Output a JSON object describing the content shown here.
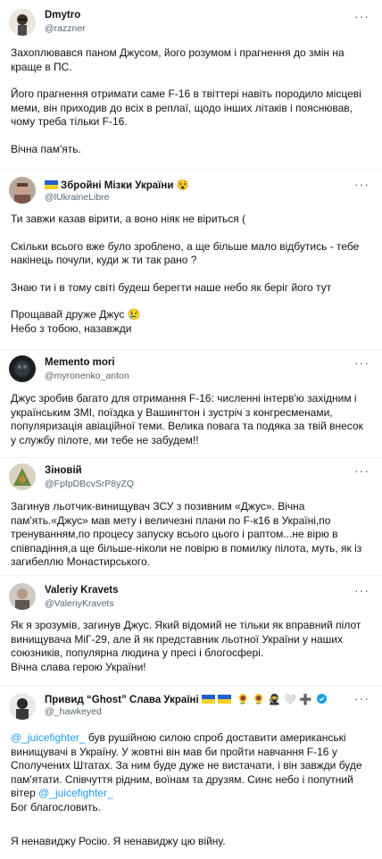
{
  "tweets": [
    {
      "name": "Dmytro",
      "handle": "@razzner",
      "more": "···",
      "lines": [
        "Захоплювався паном Джусом, його розумом і прагнення до змін на краще в ПС.",
        "",
        "Його прагнення отримати саме F-16 в твіттері навіть породило місцеві меми, він приходив до всіх в реплаї, щодо інших літаків і пояснював, чому треба тільки F-16.",
        "",
        "Вічна пам'ять."
      ]
    },
    {
      "name": "Збройні Мізки України",
      "name_emoji": "😵",
      "handle": "@lUkraineLibre",
      "more": "···",
      "lines": [
        "Ти завжи казав вірити, а воно ніяк не віриться (",
        "",
        "Скільки всього вже було зроблено, а ще більше мало відбутись - тебе накінець почули, куди ж ти так рано ?",
        "",
        "Знаю ти і в тому світі будеш берегти наше небо як беріг його тут",
        "",
        "Прощавай друже Джус 😢",
        "Небо з тобою, назавжди"
      ]
    },
    {
      "name": "Memento mori",
      "handle": "@myronenko_anton",
      "more": "···",
      "lines": [
        "Джус зробив багато для отримання F-16: численні інтерв'ю західним і українським ЗМІ, поїздка у Вашингтон і зустріч з конгресменами, популяризація авіаційної теми. Велика повага та подяка за твій внесок у службу пілоте, ми тебе не забудем!!"
      ]
    },
    {
      "name": "Зіновій",
      "handle": "@FpfpDBcvSrP8yZQ",
      "more": "···",
      "lines": [
        "Загинув льотчик-винищувач  ЗСУ з позивним «Джус». Вічна пам'ять.«Джус» мав мету і величезні плани по F-к16 в Україні,по тренуванням,по процесу запуску всього цього і раптом...не вірю в співпадіння,а ще більше-ніколи не повірю в помилку пілота, муть, як із загибеллю Монастирського."
      ]
    },
    {
      "name": "Valeriy Kravets",
      "handle": "@ValeriyKravets",
      "more": "···",
      "lines": [
        "Як я зрозумів, загинув Джус. Який відомий не тільки як вправний пілот винищувача МіГ-29, але й як представник льотної України у наших союзників, популярна людина у пресі і блогосфері.",
        "Вічна слава герою України!"
      ]
    },
    {
      "name": "Привид “Ghost” Слава Україні",
      "name_emoji": "🌻 🌻 🥷 🤍 ➕",
      "handle": "@_hawkeyed",
      "more": "···",
      "mention1": "@_juicefighter_",
      "text1": " був рушійною силою спроб доставити американські винищувачі в Україну. У жовтні він мав би пройти навчання F-16 у Сполучених Штатах. За ним буде дуже не вистачати, і він завжди буде пам'ятати. Співчуття рідним, воїнам та друзям. Синє небо і попутний вітер ",
      "mention2": "@_juicefighter_",
      "line2": "Бог благословить.",
      "line3": "Я ненавиджу Росію. Я ненавиджу цю війну."
    }
  ]
}
